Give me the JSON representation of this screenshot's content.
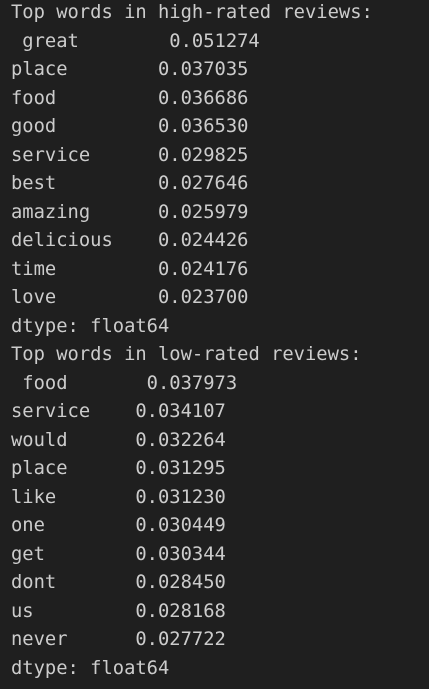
{
  "high": {
    "title": "Top words in high-rated reviews:",
    "rows": [
      {
        "word": "great",
        "value": "0.051274"
      },
      {
        "word": "place",
        "value": "0.037035"
      },
      {
        "word": "food",
        "value": "0.036686"
      },
      {
        "word": "good",
        "value": "0.036530"
      },
      {
        "word": "service",
        "value": "0.029825"
      },
      {
        "word": "best",
        "value": "0.027646"
      },
      {
        "word": "amazing",
        "value": "0.025979"
      },
      {
        "word": "delicious",
        "value": "0.024426"
      },
      {
        "word": "time",
        "value": "0.024176"
      },
      {
        "word": "love",
        "value": "0.023700"
      }
    ],
    "dtype": "dtype: float64"
  },
  "low": {
    "title": "Top words in low-rated reviews:",
    "rows": [
      {
        "word": "food",
        "value": "0.037973"
      },
      {
        "word": "service",
        "value": "0.034107"
      },
      {
        "word": "would",
        "value": "0.032264"
      },
      {
        "word": "place",
        "value": "0.031295"
      },
      {
        "word": "like",
        "value": "0.031230"
      },
      {
        "word": "one",
        "value": "0.030449"
      },
      {
        "word": "get",
        "value": "0.030344"
      },
      {
        "word": "dont",
        "value": "0.028450"
      },
      {
        "word": "us",
        "value": "0.028168"
      },
      {
        "word": "never",
        "value": "0.027722"
      }
    ],
    "dtype": "dtype: float64"
  }
}
